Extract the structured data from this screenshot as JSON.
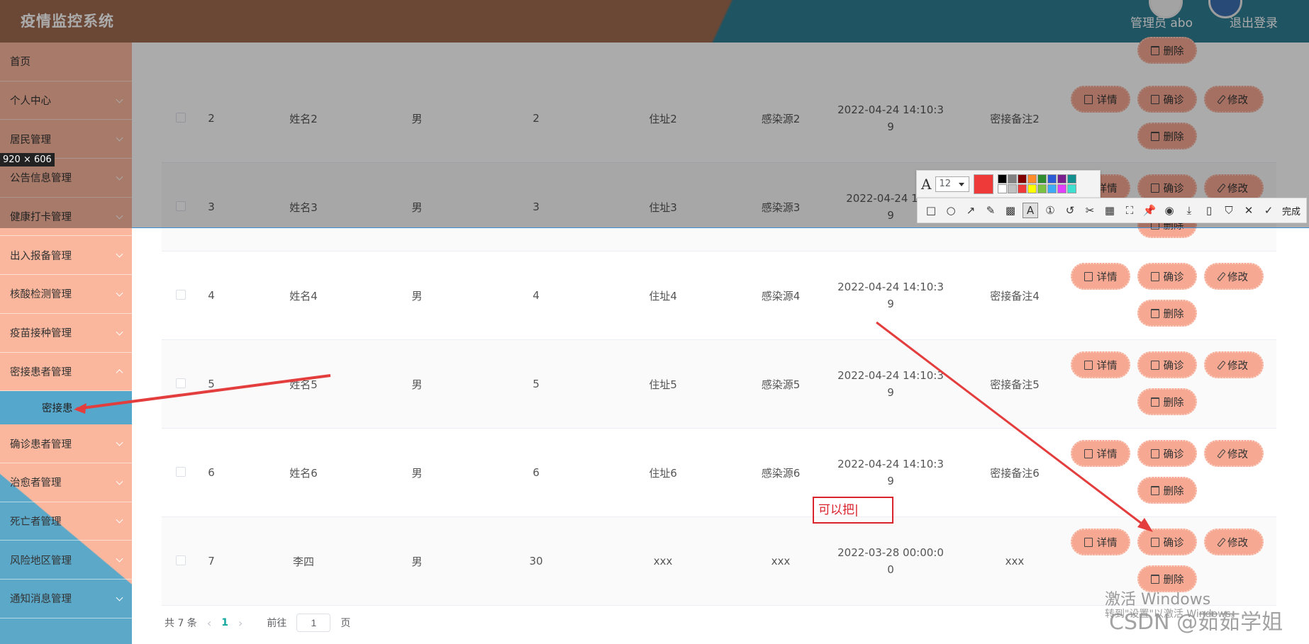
{
  "header": {
    "title": "疫情监控系统",
    "user": "管理员 abo",
    "logout": "退出登录"
  },
  "sidebar": {
    "items": [
      {
        "label": "首页"
      },
      {
        "label": "个人中心"
      },
      {
        "label": "居民管理"
      },
      {
        "label": "公告信息管理"
      },
      {
        "label": "健康打卡管理"
      },
      {
        "label": "出入报备管理"
      },
      {
        "label": "核酸检测管理"
      },
      {
        "label": "疫苗接种管理"
      },
      {
        "label": "密接患者管理"
      }
    ],
    "submenu": "密接患",
    "items2": [
      {
        "label": "确诊患者管理"
      },
      {
        "label": "治愈者管理"
      },
      {
        "label": "死亡者管理"
      },
      {
        "label": "风险地区管理"
      },
      {
        "label": "通知消息管理"
      }
    ]
  },
  "size_badge": "920 × 606",
  "table": {
    "rows": [
      {
        "id": "2",
        "name": "姓名2",
        "sex": "男",
        "age": "2",
        "addr": "住址2",
        "src": "感染源2",
        "time1": "2022-04-24 14:10:3",
        "time2": "9",
        "note": "密接备注2"
      },
      {
        "id": "3",
        "name": "姓名3",
        "sex": "男",
        "age": "3",
        "addr": "住址3",
        "src": "感染源3",
        "time1": "2022-04-24 14:1",
        "time2": "9",
        "note": ""
      },
      {
        "id": "4",
        "name": "姓名4",
        "sex": "男",
        "age": "4",
        "addr": "住址4",
        "src": "感染源4",
        "time1": "2022-04-24 14:10:3",
        "time2": "9",
        "note": "密接备注4"
      },
      {
        "id": "5",
        "name": "姓名5",
        "sex": "男",
        "age": "5",
        "addr": "住址5",
        "src": "感染源5",
        "time1": "2022-04-24 14:10:3",
        "time2": "9",
        "note": "密接备注5"
      },
      {
        "id": "6",
        "name": "姓名6",
        "sex": "男",
        "age": "6",
        "addr": "住址6",
        "src": "感染源6",
        "time1": "2022-04-24 14:10:3",
        "time2": "9",
        "note": "密接备注6"
      },
      {
        "id": "7",
        "name": "李四",
        "sex": "男",
        "age": "30",
        "addr": "xxx",
        "src": "xxx",
        "time1": "2022-03-28 00:00:0",
        "time2": "0",
        "note": "xxx"
      }
    ],
    "buttons": {
      "detail": "详情",
      "diagnose": "确诊",
      "edit": "修改",
      "delete": "删除"
    }
  },
  "pagination": {
    "total": "共 7 条",
    "current": "1",
    "goto_label": "前往",
    "goto_value": "1",
    "page_suffix": "页"
  },
  "screenshot_tool": {
    "font_size": "12",
    "done": "完成",
    "text_box": "可以把",
    "current_color": "#ef3a3a",
    "palette": [
      "#000000",
      "#808080",
      "#800000",
      "#ff8c2b",
      "#2e8b2e",
      "#2c5bd6",
      "#7a1f8f",
      "#148f8f",
      "#ffffff",
      "#c0c0c0",
      "#ef3a3a",
      "#ffff00",
      "#7cc242",
      "#3fa9f5",
      "#e040fb",
      "#40e0d0"
    ]
  },
  "watermarks": {
    "activate": "激活 Windows",
    "activate_sub": "转到\"设置\"以激活 Windows。",
    "csdn": "CSDN @茹茹学姐"
  }
}
